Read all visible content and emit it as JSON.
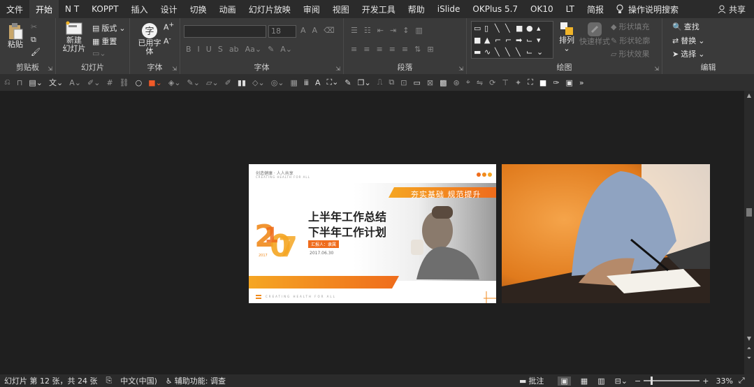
{
  "tabs": [
    "文件",
    "开始",
    "N T",
    "KOPPT",
    "插入",
    "设计",
    "切换",
    "动画",
    "幻灯片放映",
    "审阅",
    "视图",
    "开发工具",
    "帮助",
    "iSlide",
    "OKPlus 5.7",
    "OK10",
    "LT",
    "简报"
  ],
  "tell_me": "操作说明搜索",
  "share": "共享",
  "ribbon": {
    "clipboard": {
      "paste": "粘贴",
      "label": "剪贴板"
    },
    "slides": {
      "new_line1": "新建",
      "new_line2": "幻灯片",
      "layout": "版式",
      "reset": "重置",
      "label": "幻灯片"
    },
    "font_group": {
      "used_fonts_line1": "已用字",
      "used_fonts_line2": "体",
      "label": "字体"
    },
    "font": {
      "size": "18",
      "label": "字体"
    },
    "paragraph": {
      "label": "段落"
    },
    "drawing": {
      "arrange": "排列",
      "quick_styles": "快速样式",
      "fill": "形状填充",
      "outline": "形状轮廓",
      "effects": "形状效果",
      "label": "绘图"
    },
    "editing": {
      "find": "查找",
      "replace": "替换",
      "select": "选择",
      "label": "编辑"
    }
  },
  "slide": {
    "brand": "创造健康 · 人人共享",
    "brand_en": "CREATING HEALTH FOR ALL",
    "banner": "夯实基础  规范提升",
    "year": "2017",
    "title_line1": "上半年工作总结",
    "title_line2": "下半年工作计划",
    "reporter": "汇报人：隶属",
    "date": "2017.06.30",
    "footer_en": "CREATING HEALTH FOR ALL"
  },
  "status": {
    "slide_info": "幻灯片 第 12 张，共 24 张",
    "language": "中文(中国)",
    "accessibility": "辅助功能: 调查",
    "notes": "批注",
    "zoom": "33%"
  },
  "colors": {
    "accent": "#f08a1c",
    "ribbon_bg": "#3a3a3a",
    "tab_bg": "#2b2b2b",
    "canvas_bg": "#1f1f1f"
  }
}
